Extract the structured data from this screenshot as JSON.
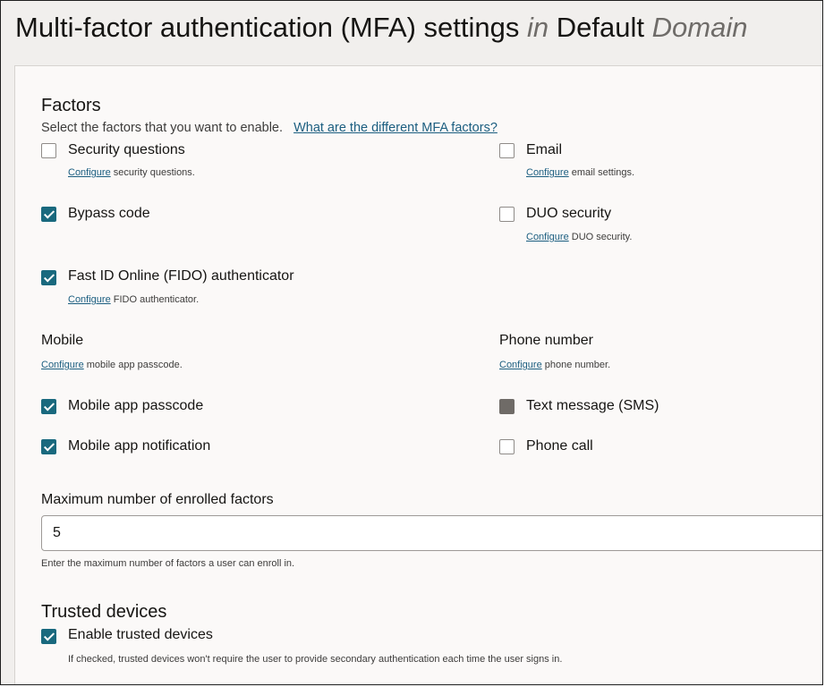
{
  "page": {
    "title_part1": "Multi-factor authentication (MFA) settings",
    "title_in": "in",
    "title_part2": "Default",
    "title_domain": "Domain"
  },
  "factors": {
    "heading": "Factors",
    "description": "Select the factors that you want to enable.",
    "help_link": "What are the different MFA factors?",
    "configure_link": "Configure",
    "items": {
      "security_questions": {
        "label": "Security questions",
        "checked": false,
        "hint": " security questions."
      },
      "email": {
        "label": "Email",
        "checked": false,
        "hint": " email settings."
      },
      "bypass_code": {
        "label": "Bypass code",
        "checked": true
      },
      "duo_security": {
        "label": "DUO security",
        "checked": false,
        "hint": " DUO security."
      },
      "fido": {
        "label": "Fast ID Online (FIDO) authenticator",
        "checked": true,
        "hint": " FIDO authenticator."
      }
    }
  },
  "mobile": {
    "heading": "Mobile",
    "hint": " mobile app passcode.",
    "items": {
      "passcode": {
        "label": "Mobile app passcode",
        "checked": true
      },
      "notification": {
        "label": "Mobile app notification",
        "checked": true
      }
    }
  },
  "phone": {
    "heading": "Phone number",
    "hint": " phone number.",
    "items": {
      "sms": {
        "label": "Text message (SMS)",
        "checked": true,
        "disabled": true
      },
      "call": {
        "label": "Phone call",
        "checked": false
      }
    }
  },
  "max_factors": {
    "label": "Maximum number of enrolled factors",
    "value": "5",
    "help": "Enter the maximum number of factors a user can enroll in."
  },
  "trusted_devices": {
    "heading": "Trusted devices",
    "enable_label": "Enable trusted devices",
    "checked": true,
    "help": "If checked, trusted devices won't require the user to provide secondary authentication each time the user signs in."
  }
}
